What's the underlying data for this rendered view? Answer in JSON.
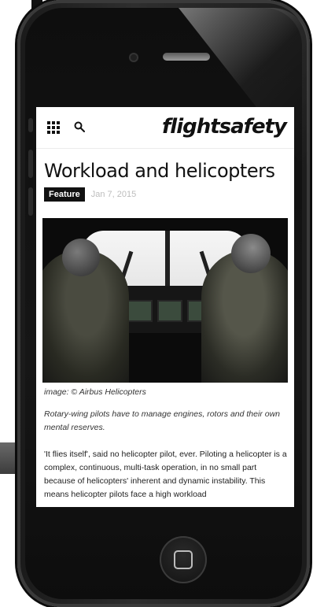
{
  "site": {
    "logo_text": "flightsafety"
  },
  "article": {
    "title": "Workload and helicopters",
    "category": "Feature",
    "date": "Jan 7, 2015",
    "image_caption": "image: © Airbus Helicopters",
    "lede": "Rotary-wing pilots have to manage engines, rotors and their own mental reserves.",
    "body": "'It flies itself', said no helicopter pilot, ever. Piloting a helicopter is a complex, continuous, multi-task operation, in no small part because of helicopters' inherent and dynamic instability. This means helicopter pilots face a high workload"
  },
  "icons": {
    "menu": "grid-menu-icon",
    "search": "search-icon",
    "home": "home-button-icon"
  },
  "colors": {
    "badge_bg": "#111111",
    "date_text": "#bdbdbd"
  }
}
